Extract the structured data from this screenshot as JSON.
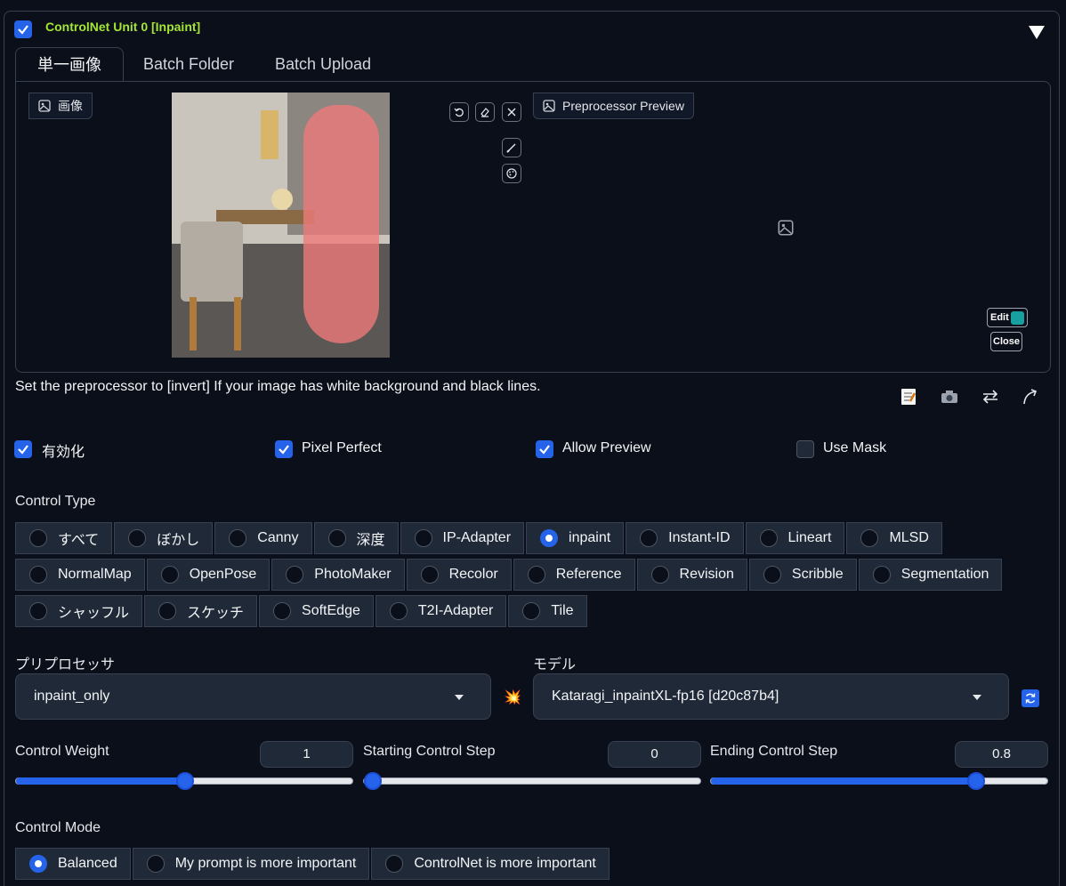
{
  "unit": {
    "title": "ControlNet Unit 0  [Inpaint]",
    "enabled_checked": true
  },
  "tabs": [
    "単一画像",
    "Batch Folder",
    "Batch Upload"
  ],
  "image_panel": {
    "image_label": "画像",
    "preview_label": "Preprocessor Preview",
    "edit_label": "Edit",
    "close_label": "Close"
  },
  "hint": "Set the preprocessor to [invert] If your image has white background and black lines.",
  "options": {
    "enable": {
      "label": "有効化",
      "checked": true
    },
    "pixel_perfect": {
      "label": "Pixel Perfect",
      "checked": true
    },
    "allow_preview": {
      "label": "Allow Preview",
      "checked": true
    },
    "use_mask": {
      "label": "Use Mask",
      "checked": false
    }
  },
  "control_type": {
    "label": "Control Type",
    "selected": "inpaint",
    "rows": [
      [
        "すべて",
        "ぼかし",
        "Canny",
        "深度",
        "IP-Adapter",
        "inpaint",
        "Instant-ID",
        "Lineart",
        "MLSD"
      ],
      [
        "NormalMap",
        "OpenPose",
        "PhotoMaker",
        "Recolor",
        "Reference",
        "Revision",
        "Scribble",
        "Segmentation"
      ],
      [
        "シャッフル",
        "スケッチ",
        "SoftEdge",
        "T2I-Adapter",
        "Tile"
      ]
    ]
  },
  "preprocessor": {
    "label": "プリプロセッサ",
    "value": "inpaint_only"
  },
  "model": {
    "label": "モデル",
    "value": "Kataragi_inpaintXL-fp16 [d20c87b4]"
  },
  "sliders": [
    {
      "label": "Control Weight",
      "value": "1",
      "fraction": 0.5
    },
    {
      "label": "Starting Control Step",
      "value": "0",
      "fraction": 0.0
    },
    {
      "label": "Ending Control Step",
      "value": "0.8",
      "fraction": 0.8
    }
  ],
  "control_mode": {
    "label": "Control Mode",
    "selected": "Balanced",
    "options": [
      "Balanced",
      "My prompt is more important",
      "ControlNet is more important"
    ]
  },
  "colors": {
    "accent": "#2563eb",
    "title_green": "#a3e635",
    "background": "#0b0f19"
  }
}
